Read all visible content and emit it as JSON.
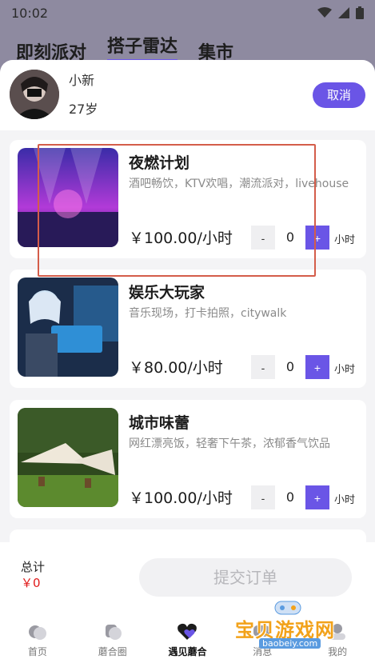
{
  "status_bar": {
    "time": "10:02"
  },
  "background_tabs": [
    "即刻派对",
    "搭子雷达",
    "集市"
  ],
  "user": {
    "name": "小新",
    "age": "27岁"
  },
  "header": {
    "cancel_label": "取消"
  },
  "packages": [
    {
      "title": "夜燃计划",
      "desc": "酒吧畅饮，KTV欢唱，潮流派对，livehouse",
      "price": "￥100.00/小时",
      "minus": "-",
      "qty": "0",
      "plus": "+",
      "unit": "小时"
    },
    {
      "title": "娱乐大玩家",
      "desc": "音乐现场，打卡拍照，citywalk",
      "price": "￥80.00/小时",
      "minus": "-",
      "qty": "0",
      "plus": "+",
      "unit": "小时"
    },
    {
      "title": "城市味蕾",
      "desc": "网红漂亮饭，轻奢下午茶，浓郁香气饮品",
      "price": "￥100.00/小时",
      "minus": "-",
      "qty": "0",
      "plus": "+",
      "unit": "小时"
    }
  ],
  "order": {
    "total_label": "总计",
    "total_value": "￥0",
    "submit_label": "提交订单"
  },
  "nav": [
    {
      "label": "首页",
      "icon": "home-icon"
    },
    {
      "label": "蘑合圈",
      "icon": "circle-icon"
    },
    {
      "label": "遇见蘑合",
      "icon": "heart-icon"
    },
    {
      "label": "消息",
      "icon": "message-icon"
    },
    {
      "label": "我的",
      "icon": "profile-icon"
    }
  ],
  "watermark": {
    "text": "宝贝游戏网",
    "url": "baobeiy.com"
  },
  "colors": {
    "accent": "#6a55e6",
    "price_red": "#e01b1b",
    "highlight": "#d45d4a"
  }
}
